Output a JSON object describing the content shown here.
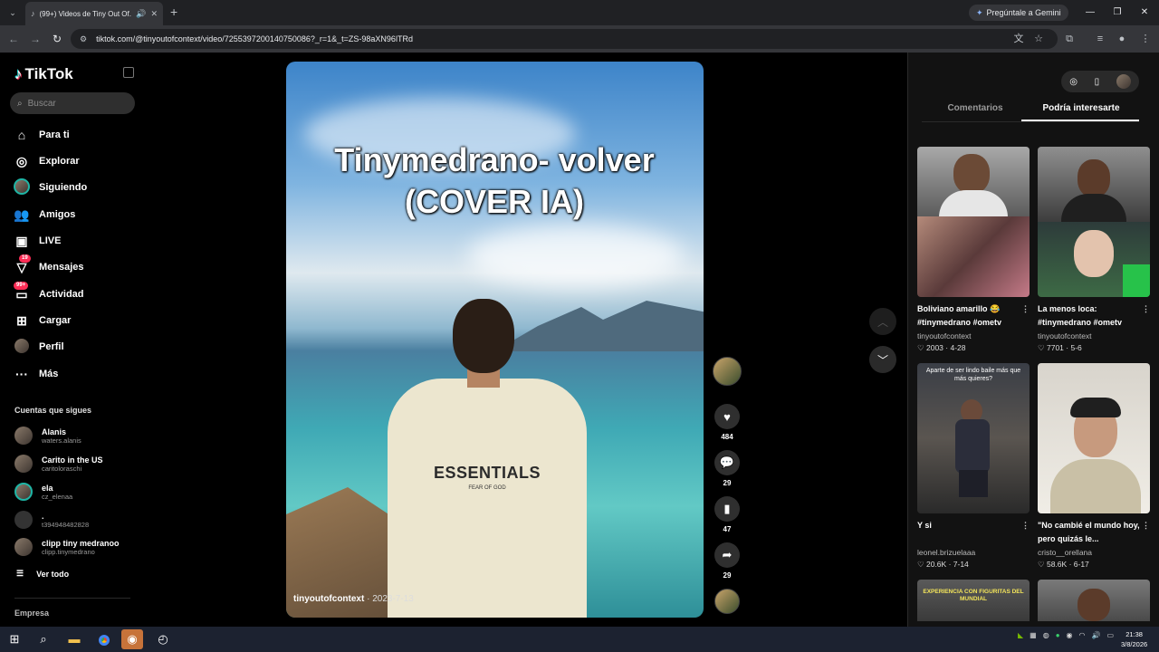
{
  "browser": {
    "tab_title": "(99+) Videos de Tiny Out Of...",
    "gemini_label": "Pregúntale a Gemini",
    "url": "tiktok.com/@tinyoutofcontext/video/7255397200140750086?_r=1&_t=ZS-98aXN96lTRd"
  },
  "sidebar": {
    "logo": "TikTok",
    "search_placeholder": "Buscar",
    "nav": [
      {
        "label": "Para ti",
        "icon": "home-icon"
      },
      {
        "label": "Explorar",
        "icon": "compass-icon"
      },
      {
        "label": "Siguiendo",
        "icon": "following-avatar"
      },
      {
        "label": "Amigos",
        "icon": "friends-icon"
      },
      {
        "label": "LIVE",
        "icon": "live-icon"
      },
      {
        "label": "Mensajes",
        "icon": "messages-icon",
        "badge": "19"
      },
      {
        "label": "Actividad",
        "icon": "activity-icon",
        "badge": "99+"
      },
      {
        "label": "Cargar",
        "icon": "upload-icon"
      },
      {
        "label": "Perfil",
        "icon": "profile-avatar"
      },
      {
        "label": "Más",
        "icon": "more-icon"
      }
    ],
    "following_heading": "Cuentas que sigues",
    "accounts": [
      {
        "name": "Alanis",
        "user": "waters.alanis"
      },
      {
        "name": "Carito in the US",
        "user": "caritoloraschi"
      },
      {
        "name": "ela",
        "user": "cz_elenaa"
      },
      {
        "name": ".",
        "user": "t394948482828"
      },
      {
        "name": "clipp tiny medranoo",
        "user": "clipp.tinymedrano"
      }
    ],
    "see_all": "Ver todo",
    "company": "Empresa"
  },
  "video": {
    "caption": "Tinymedrano- volver (COVER IA)",
    "shirt_brand": "ESSENTIALS",
    "shirt_sub": "FEAR OF GOD",
    "author": "tinyoutofcontext",
    "date": "· 2023-7-13"
  },
  "actions": {
    "likes": "484",
    "comments": "29",
    "saves": "47",
    "shares": "29"
  },
  "panel": {
    "tab_comments": "Comentarios",
    "tab_may_like": "Podría interesarte",
    "cards": [
      {
        "title": "Boliviano amarillo 😂 #tinymedrano #ometv",
        "user": "tinyoutofcontext",
        "likes": "2003",
        "date": "4-28"
      },
      {
        "title": "La menos loca: #tinymedrano #ometv",
        "user": "tinyoutofcontext",
        "likes": "7701",
        "date": "5-6"
      },
      {
        "title": "Y si",
        "user": "leonel.brizuelaaa",
        "likes": "20.6K",
        "date": "7-14",
        "overlay": "Aparte de ser lindo baile más que más quieres?"
      },
      {
        "title": "\"No cambié el mundo hoy, pero quizás le...",
        "user": "cristo__orellana",
        "likes": "58.6K",
        "date": "6-17"
      },
      {
        "overlay": "EXPERIENCIA CON FIGURITAS DEL MUNDIAL"
      }
    ]
  },
  "taskbar": {
    "time": "21:38",
    "date": "3/8/2026"
  }
}
